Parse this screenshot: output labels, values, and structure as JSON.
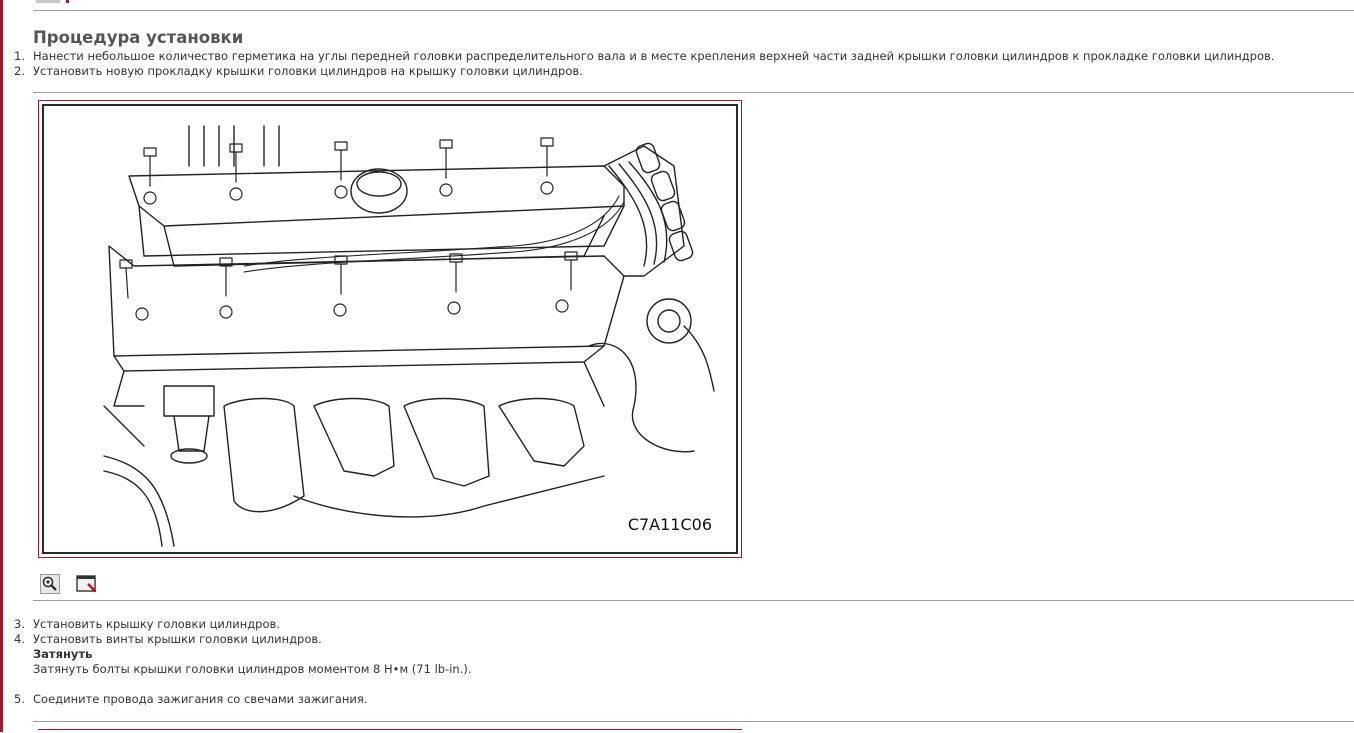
{
  "section": {
    "title": "Процедура установки"
  },
  "steps_top": [
    {
      "num": "1.",
      "text": "Нанести небольшое количество герметика на углы передней головки распределительного вала и в месте крепления верхней части задней крышки головки цилиндров к прокладке головки цилиндров."
    },
    {
      "num": "2.",
      "text": "Установить новую прокладку крышки головки цилиндров на крышку головки цилиндров."
    }
  ],
  "figure": {
    "code": "C7A11C06"
  },
  "toolbar": {
    "zoom_icon": "zoom-in-icon",
    "window_icon": "open-window-icon"
  },
  "steps_bottom": [
    {
      "num": "3.",
      "text": "Установить крышку головки цилиндров."
    },
    {
      "num": "4.",
      "text": "Установить винты крышки головки цилиндров."
    }
  ],
  "torque": {
    "heading": "Затянуть",
    "text": "Затянуть болты крышки головки цилиндров моментом 8 Н•м (71 lb-in.)."
  },
  "steps_final": [
    {
      "num": "5.",
      "text": "Соедините провода зажигания со свечами зажигания."
    }
  ],
  "colors": {
    "accent": "#9b1c2e",
    "rule": "#a0a0a0",
    "text": "#333333"
  }
}
